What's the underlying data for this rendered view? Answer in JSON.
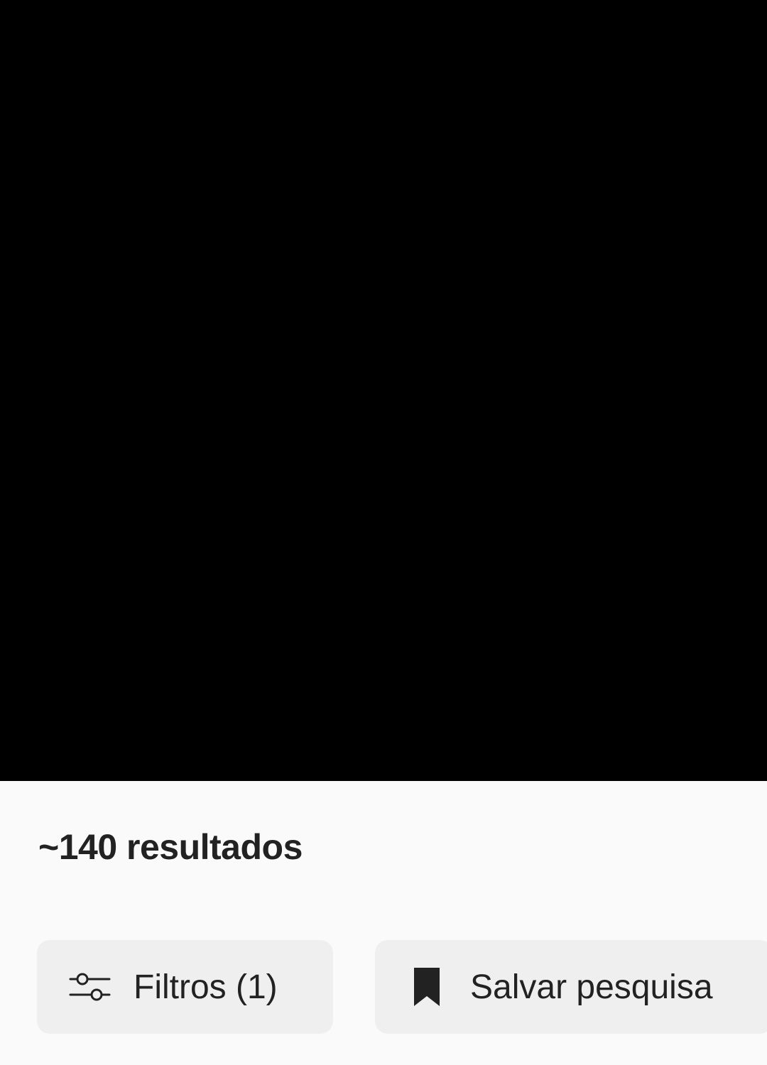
{
  "results": {
    "count_text": "~140 resultados"
  },
  "actions": {
    "filters_label": "Filtros (1)",
    "save_search_label": "Salvar pesquisa"
  },
  "icons": {
    "filters": "sliders-icon",
    "save_search": "bookmark-icon"
  },
  "colors": {
    "media_background": "#000000",
    "panel_background": "#fafafa",
    "button_background": "#efefef",
    "text": "#222222"
  }
}
